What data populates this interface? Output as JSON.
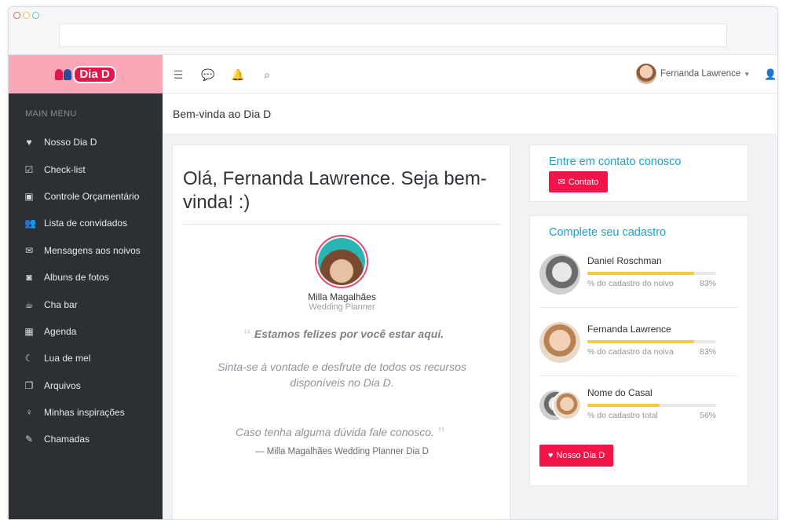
{
  "brand": {
    "logo_text": "Dia D",
    "primary_color": "#f2154a",
    "logo_bar_color": "#fba7b8",
    "accent_color": "#1aa1c9"
  },
  "topbar": {
    "icons": [
      "menu-collapse-icon",
      "chat-icon",
      "bell-icon",
      "search-icon"
    ],
    "user_name": "Fernanda Lawrence"
  },
  "sidebar": {
    "title": "MAIN MENU",
    "items": [
      {
        "label": "Nosso Dia D",
        "icon": "heart-icon",
        "glyph": "♥"
      },
      {
        "label": "Check-list",
        "icon": "checklist-icon",
        "glyph": "☑"
      },
      {
        "label": "Controle Orçamentário",
        "icon": "money-icon",
        "glyph": "▣"
      },
      {
        "label": "Lista de convidados",
        "icon": "guests-icon",
        "glyph": "👥"
      },
      {
        "label": "Mensagens aos noivos",
        "icon": "message-icon",
        "glyph": "✉"
      },
      {
        "label": "Albuns de fotos",
        "icon": "camera-icon",
        "glyph": "◙"
      },
      {
        "label": "Cha bar",
        "icon": "cha-bar-icon",
        "glyph": "☕"
      },
      {
        "label": "Agenda",
        "icon": "calendar-icon",
        "glyph": "▦"
      },
      {
        "label": "Lua de mel",
        "icon": "moon-icon",
        "glyph": "☾"
      },
      {
        "label": "Arquivos",
        "icon": "files-icon",
        "glyph": "❐"
      },
      {
        "label": "Minhas inspirações",
        "icon": "lightbulb-icon",
        "glyph": "♀"
      },
      {
        "label": "Chamadas",
        "icon": "support-icon",
        "glyph": "✎"
      }
    ]
  },
  "breadcrumb": "Bem-vinda ao Dia D",
  "welcome": {
    "heading": "Olá, Fernanda Lawrence. Seja bem-vinda! :)",
    "planner_name": "Milla Magalhães",
    "planner_role": "Wedding Planner",
    "quote_main": "Estamos felizes por você estar aqui.",
    "quote_body": "Sinta-se à vontade e desfrute de todos os recursos disponíveis no Dia D.",
    "quote_help": "Caso tenha alguma dúvida fale conosco.",
    "signature": "— Milla Magalhães Wedding Planner Dia D"
  },
  "contact": {
    "title": "Entre em contato conosco",
    "button": "Contato"
  },
  "profile": {
    "title": "Complete seu cadastro",
    "people": [
      {
        "name": "Daniel Roschman",
        "label": "% do cadastro do noivo",
        "pct_text": "83%",
        "pct": 83
      },
      {
        "name": "Fernanda Lawrence",
        "label": "% do cadastro da noiva",
        "pct_text": "83%",
        "pct": 83
      },
      {
        "name": "Nome do Casal",
        "label": "% do cadastro total",
        "pct_text": "56%",
        "pct": 56
      }
    ],
    "button": "Nosso Dia D"
  }
}
